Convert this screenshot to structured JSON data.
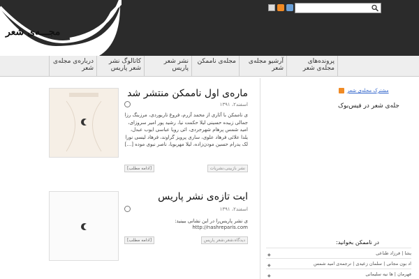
{
  "header": {
    "logo_text": "مجـــەی شعر",
    "search": {
      "placeholder": "",
      "value": ""
    }
  },
  "nav": {
    "items": [
      {
        "label": "پرونده‌های مجله‌ی شعر"
      },
      {
        "label": "آرشیو مجله‌ی شعر"
      },
      {
        "label": "مجله‌ی ناممکن"
      },
      {
        "label": "نشر شعر پاریس"
      },
      {
        "label": "کاتالوگ نشر شعر پاریس"
      },
      {
        "label": "درباره‌ی مجله‌ی شعر"
      }
    ]
  },
  "posts": [
    {
      "title": "ماره‌ی اول ناممکن منتشر شد",
      "date": "اسفند۲، ۱۳۹۱",
      "excerpt": "ی ناممکن با آثاری از محمد آزرم، فروغ تاریوردی، مرزبنگ رزا جمالی زبیده حسینی لیلا حکمت نیا، رشید پور امیر سروزای، امید شمس پرهام شهرجردی، ائی رویا عباسی ایوب عبدل، یلدا علائی فرهاد علوی، ساری پرویز گراوند، فرهاد لیسی نورا لک یدرام حسین مودن‌زاده، لیلا مهربویا، ناصر نبوی موده [...]",
      "more_label": "[ادامه مطلب]",
      "tag": "نشر بازبینی،نشریات"
    },
    {
      "title": "ایت تازه‌ی نشر پاریس",
      "date": "اسفند۲، ۱۳۹۱",
      "excerpt": "ی نشر پاریس‌را در این نشانی ببینید:",
      "url": "http://nashreparis.com",
      "more_label": "[ادامه مطلب]",
      "tag": "دیدگاه،شعر،شعر پاریس"
    }
  ],
  "sidebar": {
    "rss_label": "مشترک مجله‌ی شعر",
    "facebook_line": "جله‌ی شعر در فیس‌بوک",
    "section_title": "در ناممکن بخوانید:",
    "items": [
      {
        "label": "یشا | فرزاد طناعی"
      },
      {
        "label": "اد بون مجانی | سلمان زعیدی | ترجمه‌ی امید شمس"
      },
      {
        "label": "فهرمان | ها نیه سلیمانی"
      }
    ]
  }
}
